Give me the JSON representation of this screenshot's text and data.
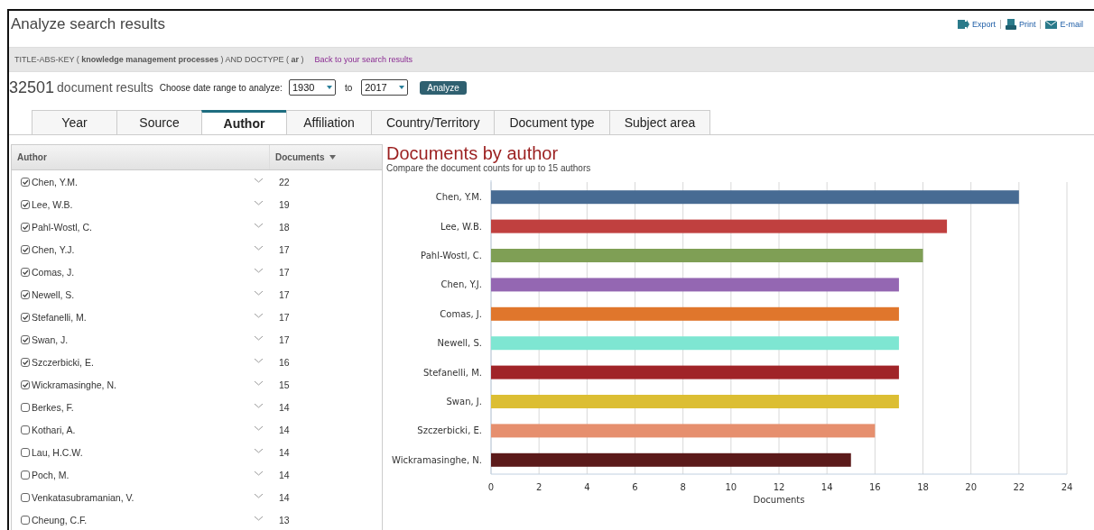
{
  "page": {
    "title": "Analyze search results",
    "actions": [
      {
        "label": "Export",
        "kind": "export"
      },
      {
        "label": "Print",
        "kind": "print"
      },
      {
        "label": "E-mail",
        "kind": "email"
      }
    ]
  },
  "query": {
    "text": "TITLE-ABS-KEY ( **knowledge  management  processes** )  AND  DOCTYPE ( **ar** )",
    "link": "Back to your search results"
  },
  "results": {
    "count": "32501",
    "label": "document results",
    "range_label": "Choose date range to analyze:",
    "from": "1930",
    "to_label": "to",
    "to": "2017",
    "button": "Analyze"
  },
  "tabs": [
    {
      "label": "Year",
      "selected": false
    },
    {
      "label": "Source",
      "selected": false
    },
    {
      "label": "Author",
      "selected": true
    },
    {
      "label": "Affiliation",
      "selected": false
    },
    {
      "label": "Country/Territory",
      "selected": false
    },
    {
      "label": "Document type",
      "selected": false
    },
    {
      "label": "Subject area",
      "selected": false
    }
  ],
  "authors": {
    "columns": [
      "Author",
      "Documents"
    ],
    "rows": [
      {
        "name": "Chen, Y.M.",
        "count": "22",
        "checked": true
      },
      {
        "name": "Lee, W.B.",
        "count": "19",
        "checked": true
      },
      {
        "name": "Pahl-Wostl, C.",
        "count": "18",
        "checked": true
      },
      {
        "name": "Chen, Y.J.",
        "count": "17",
        "checked": true
      },
      {
        "name": "Comas, J.",
        "count": "17",
        "checked": true
      },
      {
        "name": "Newell, S.",
        "count": "17",
        "checked": true
      },
      {
        "name": "Stefanelli, M.",
        "count": "17",
        "checked": true
      },
      {
        "name": "Swan, J.",
        "count": "17",
        "checked": true
      },
      {
        "name": "Szczerbicki, E.",
        "count": "16",
        "checked": true
      },
      {
        "name": "Wickramasinghe, N.",
        "count": "15",
        "checked": true
      },
      {
        "name": "Berkes, F.",
        "count": "14",
        "checked": false
      },
      {
        "name": "Kothari, A.",
        "count": "14",
        "checked": false
      },
      {
        "name": "Lau, H.C.W.",
        "count": "14",
        "checked": false
      },
      {
        "name": "Poch, M.",
        "count": "14",
        "checked": false
      },
      {
        "name": "Venkatasubramanian, V.",
        "count": "14",
        "checked": false
      },
      {
        "name": "Cheung, C.F.",
        "count": "13",
        "checked": false
      }
    ]
  },
  "chart": {
    "heading": "Documents by author",
    "subtitle": "Compare the document counts for up to 15 authors",
    "chart_data": {
      "type": "bar",
      "orientation": "horizontal",
      "xlabel": "Documents",
      "categories": [
        "Chen, Y.M.",
        "Lee, W.B.",
        "Pahl-Wostl, C.",
        "Chen, Y.J.",
        "Comas, J.",
        "Newell, S.",
        "Stefanelli, M.",
        "Swan, J.",
        "Szczerbicki, E.",
        "Wickramasinghe, N."
      ],
      "colors": [
        "#476b93",
        "#c0403f",
        "#7f9f55",
        "#9467b2",
        "#e0762c",
        "#7ee6d2",
        "#a02428",
        "#dcbe33",
        "#e68f6e",
        "#5b1a1a"
      ],
      "values": [
        22,
        19,
        18,
        17,
        17,
        17,
        17,
        17,
        16,
        15
      ],
      "grid": true,
      "xlim": [
        0,
        24
      ],
      "xticks": [
        0,
        2,
        4,
        6,
        8,
        10,
        12,
        14,
        16,
        18,
        20,
        22,
        24
      ]
    }
  }
}
